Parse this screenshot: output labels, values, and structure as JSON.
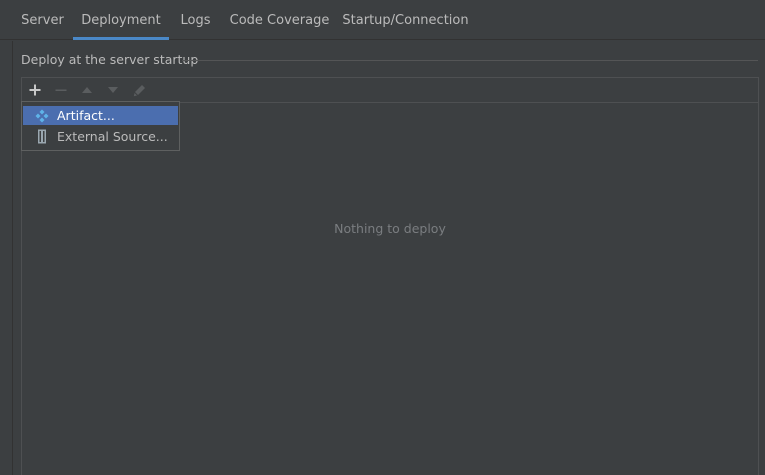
{
  "tabs": [
    {
      "label": "Server",
      "active": false
    },
    {
      "label": "Deployment",
      "active": true
    },
    {
      "label": "Logs",
      "active": false
    },
    {
      "label": "Code Coverage",
      "active": false
    },
    {
      "label": "Startup/Connection",
      "active": false
    }
  ],
  "section": {
    "title": "Deploy at the server startup"
  },
  "toolbar": {
    "buttons": [
      {
        "icon": "add-icon",
        "enabled": true
      },
      {
        "icon": "remove-icon",
        "enabled": false
      },
      {
        "icon": "move-up-icon",
        "enabled": false
      },
      {
        "icon": "move-down-icon",
        "enabled": false
      },
      {
        "icon": "edit-icon",
        "enabled": false
      }
    ]
  },
  "deploy_list": {
    "empty_text": "Nothing to deploy"
  },
  "add_menu": {
    "items": [
      {
        "label": "Artifact...",
        "icon": "artifact-icon",
        "selected": true
      },
      {
        "label": "External Source...",
        "icon": "external-source-icon",
        "selected": false
      }
    ]
  },
  "colors": {
    "background": "#3c3f41",
    "accent": "#4a88c7",
    "selection": "#4b6eaf",
    "text": "#bbbbbb",
    "muted_text": "#7a7d80"
  }
}
